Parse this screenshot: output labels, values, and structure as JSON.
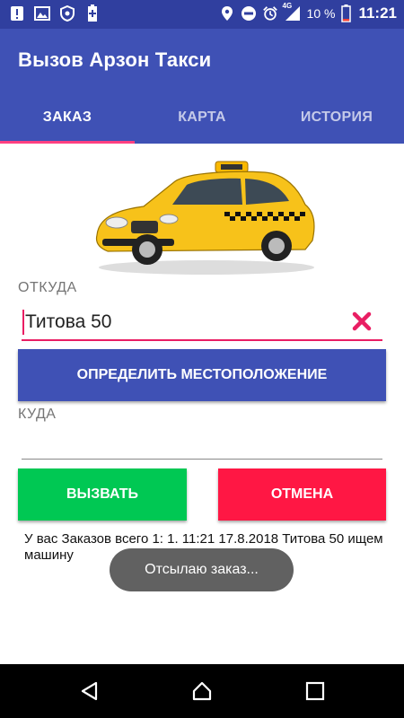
{
  "status_bar": {
    "icons_left": [
      "alert-icon",
      "image-icon",
      "shield-icon",
      "battery-plus-icon"
    ],
    "icons_right": [
      "location-icon",
      "dnd-icon",
      "alarm-icon",
      "signal-4g-icon",
      "battery-icon"
    ],
    "network": "4G",
    "battery": "10 %",
    "time": "11:21"
  },
  "app": {
    "title": "Вызов Арзон Такси"
  },
  "tabs": [
    {
      "label": "ЗАКАЗ",
      "active": true
    },
    {
      "label": "КАРТА",
      "active": false
    },
    {
      "label": "ИСТОРИЯ",
      "active": false
    }
  ],
  "form": {
    "from_label": "ОТКУДА",
    "from_value": "Титова 50",
    "locate_button": "ОПРЕДЕЛИТЬ МЕСТОПОЛОЖЕНИЕ",
    "to_label": "КУДА",
    "to_value": "",
    "call_button": "ВЫЗВАТЬ",
    "cancel_button": "ОТМЕНА"
  },
  "orders_text": "У вас Заказов всего 1:  1. 11:21 17.8.2018 Титова 50 ищем машину",
  "toast": "Отсылаю заказ...",
  "colors": {
    "status_bar": "#303f9f",
    "primary": "#3f51b5",
    "accent": "#ff4081",
    "call": "#00c853",
    "cancel": "#ff1744",
    "clear_icon": "#e91e63",
    "toast_bg": "#616161"
  }
}
